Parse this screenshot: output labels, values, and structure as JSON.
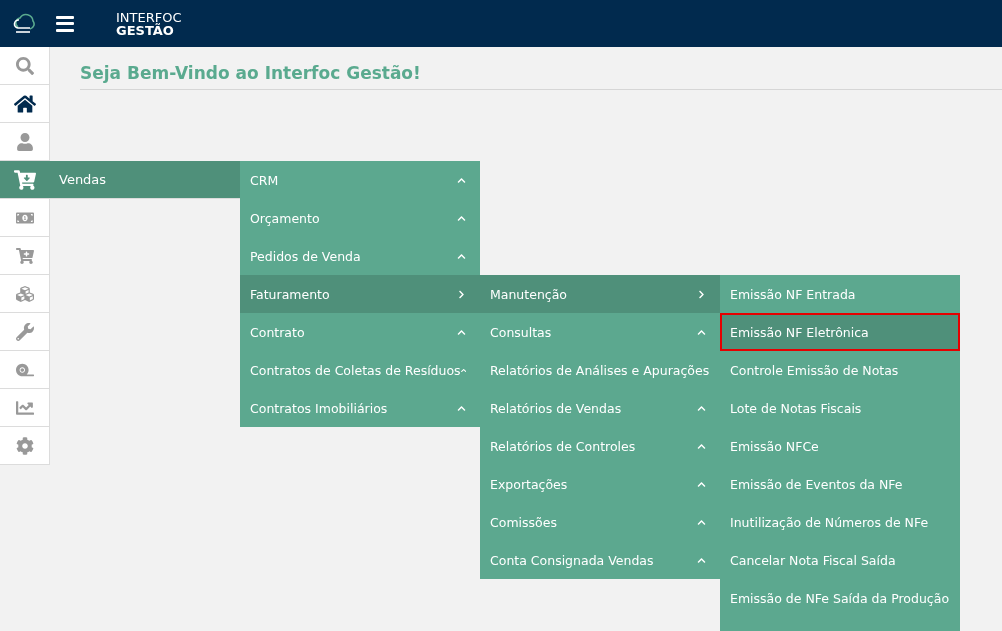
{
  "header": {
    "brand_line_1": "INTERFOC",
    "brand_line_2": "GESTÃO"
  },
  "sidebar": {
    "items": [
      {
        "selected": false
      },
      {
        "selected": false
      },
      {
        "selected": false
      },
      {
        "selected": true,
        "label": "Vendas"
      },
      {
        "selected": false
      },
      {
        "selected": false
      },
      {
        "selected": false
      },
      {
        "selected": false
      },
      {
        "selected": false
      },
      {
        "selected": false
      },
      {
        "selected": false
      }
    ]
  },
  "page_title": "Seja Bem-Vindo ao Interfoc Gestão!",
  "menus": [
    {
      "items": [
        {
          "label": "CRM",
          "expanded": false
        },
        {
          "label": "Orçamento",
          "expanded": false
        },
        {
          "label": "Pedidos de Venda",
          "expanded": false
        },
        {
          "label": "Faturamento",
          "expanded": true
        },
        {
          "label": "Contrato",
          "expanded": false
        },
        {
          "label": "Contratos de Coletas de Resíduos",
          "expanded": false
        },
        {
          "label": "Contratos Imobiliários",
          "expanded": false
        }
      ]
    },
    {
      "items": [
        {
          "label": "Manutenção",
          "expanded": true
        },
        {
          "label": "Consultas",
          "expanded": false
        },
        {
          "label": "Relatórios de Análises e Apurações",
          "expanded": false
        },
        {
          "label": "Relatórios de Vendas",
          "expanded": false
        },
        {
          "label": "Relatórios de Controles",
          "expanded": false
        },
        {
          "label": "Exportações",
          "expanded": false
        },
        {
          "label": "Comissões",
          "expanded": false
        },
        {
          "label": "Conta Consignada Vendas",
          "expanded": false
        }
      ]
    },
    {
      "items": [
        {
          "label": "Emissão NF Entrada",
          "selected": false
        },
        {
          "label": "Emissão NF Eletrônica",
          "selected": true
        },
        {
          "label": "Controle Emissão de Notas",
          "selected": false
        },
        {
          "label": "Lote de Notas Fiscais",
          "selected": false
        },
        {
          "label": "Emissão NFCe",
          "selected": false
        },
        {
          "label": "Emissão de Eventos da NFe",
          "selected": false
        },
        {
          "label": "Inutilização de Números de NFe",
          "selected": false
        },
        {
          "label": "Cancelar Nota Fiscal Saída",
          "selected": false
        },
        {
          "label": "Emissão de NFe Saída da Produção",
          "selected": false
        }
      ]
    }
  ]
}
